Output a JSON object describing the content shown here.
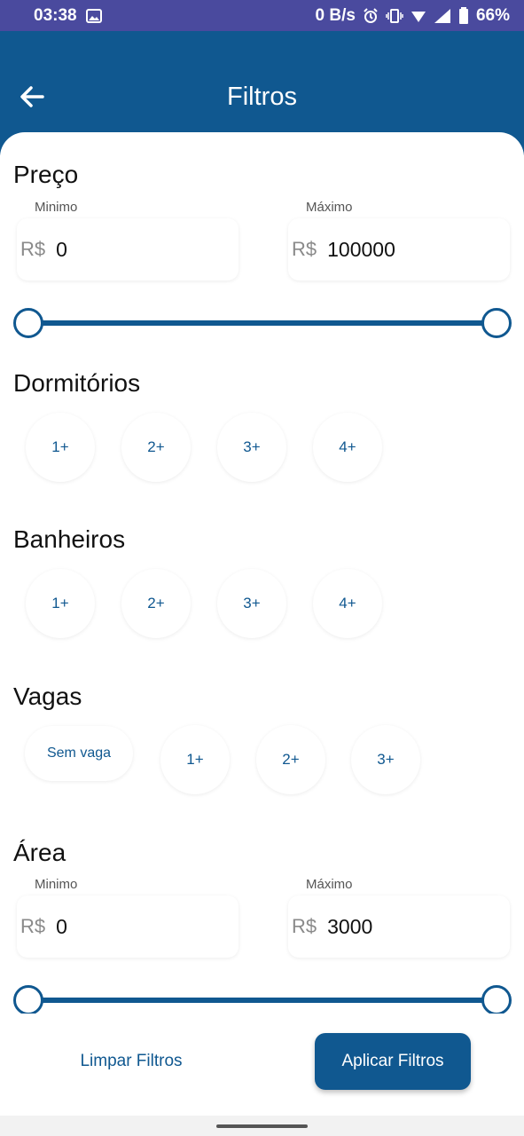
{
  "status_bar": {
    "time": "03:38",
    "speed": "0 B/s",
    "battery": "66%"
  },
  "header": {
    "title": "Filtros"
  },
  "price": {
    "title": "Preço",
    "min_label": "Minimo",
    "max_label": "Máximo",
    "currency": "R$",
    "min_value": "0",
    "max_value": "100000"
  },
  "bedrooms": {
    "title": "Dormitórios",
    "options": [
      "1+",
      "2+",
      "3+",
      "4+"
    ]
  },
  "bathrooms": {
    "title": "Banheiros",
    "options": [
      "1+",
      "2+",
      "3+",
      "4+"
    ]
  },
  "parking": {
    "title": "Vagas",
    "options": [
      "Sem vaga",
      "1+",
      "2+",
      "3+"
    ]
  },
  "area": {
    "title": "Área",
    "min_label": "Minimo",
    "max_label": "Máximo",
    "currency": "R$",
    "min_value": "0",
    "max_value": "3000"
  },
  "footer": {
    "clear_label": "Limpar Filtros",
    "apply_label": "Aplicar Filtros"
  },
  "colors": {
    "primary": "#105890",
    "status_bar": "#4a4a9e"
  }
}
